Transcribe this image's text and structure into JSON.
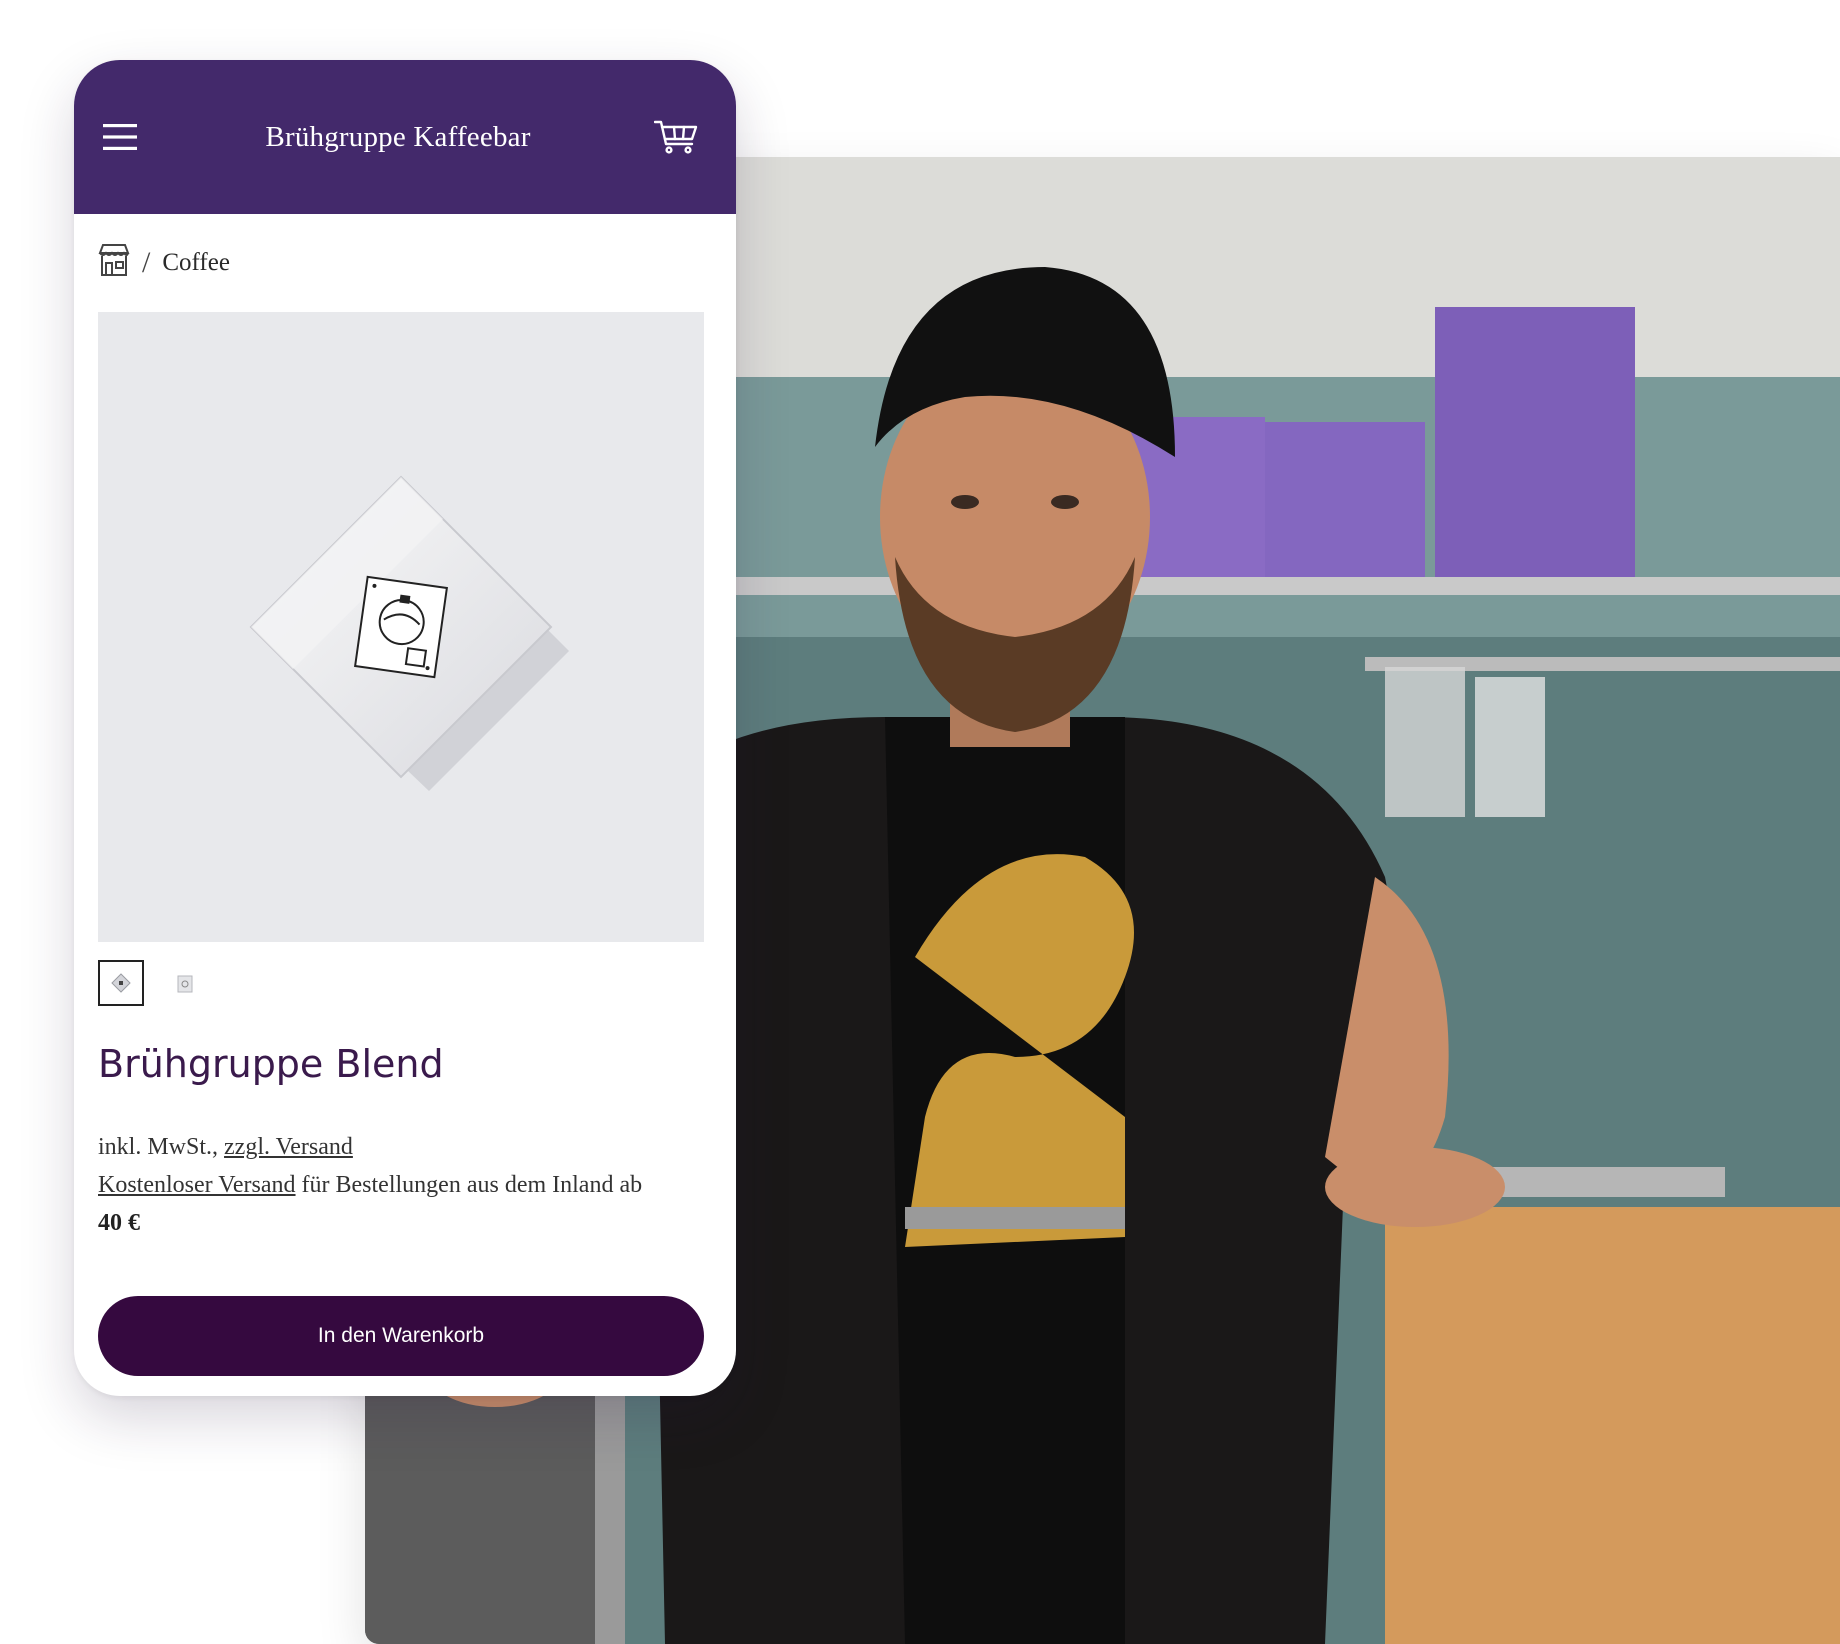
{
  "header": {
    "shop_title": "Brühgruppe Kaffeebar",
    "menu_icon": "hamburger-menu-icon",
    "cart_icon": "shopping-cart-icon"
  },
  "breadcrumb": {
    "home_icon": "storefront-icon",
    "separator": "/",
    "current": "Coffee"
  },
  "product": {
    "image_icon": "coffee-bag-image",
    "thumbnails": [
      "coffee-bag-thumbnail",
      "coffee-bag-alt-thumbnail"
    ],
    "title": "Brühgruppe Blend",
    "tax_text": "inkl. MwSt., ",
    "shipping_link": "zzgl. Versand",
    "free_shipping_link": "Kostenloser Versand",
    "free_shipping_text": " für Bestellungen aus dem Inland ab",
    "free_shipping_threshold": "40 €",
    "add_to_cart_label": "In den Warenkorb"
  },
  "colors": {
    "header_bg": "#43296b",
    "button_bg": "#35093f",
    "title_color": "#3a1a4c"
  }
}
